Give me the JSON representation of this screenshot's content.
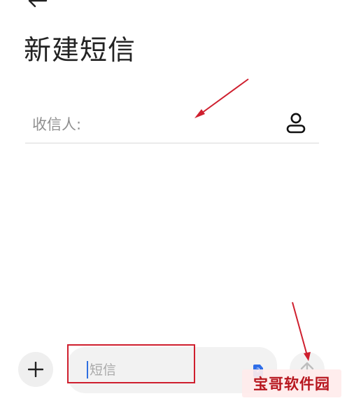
{
  "header": {
    "back_icon": "arrow-left-icon",
    "title": "新建短信"
  },
  "recipient": {
    "label": "收信人:",
    "contact_icon": "contact-person-icon"
  },
  "composer": {
    "add_icon": "plus-icon",
    "placeholder": "短信",
    "sim_icon": "sim-card-icon",
    "send_icon": "send-arrow-up-icon"
  },
  "colors": {
    "annotation": "#cf1f2e",
    "caret": "#2f6fe0",
    "field_bg": "#f2f2f2"
  },
  "watermark": {
    "text": "宝哥软件园"
  }
}
